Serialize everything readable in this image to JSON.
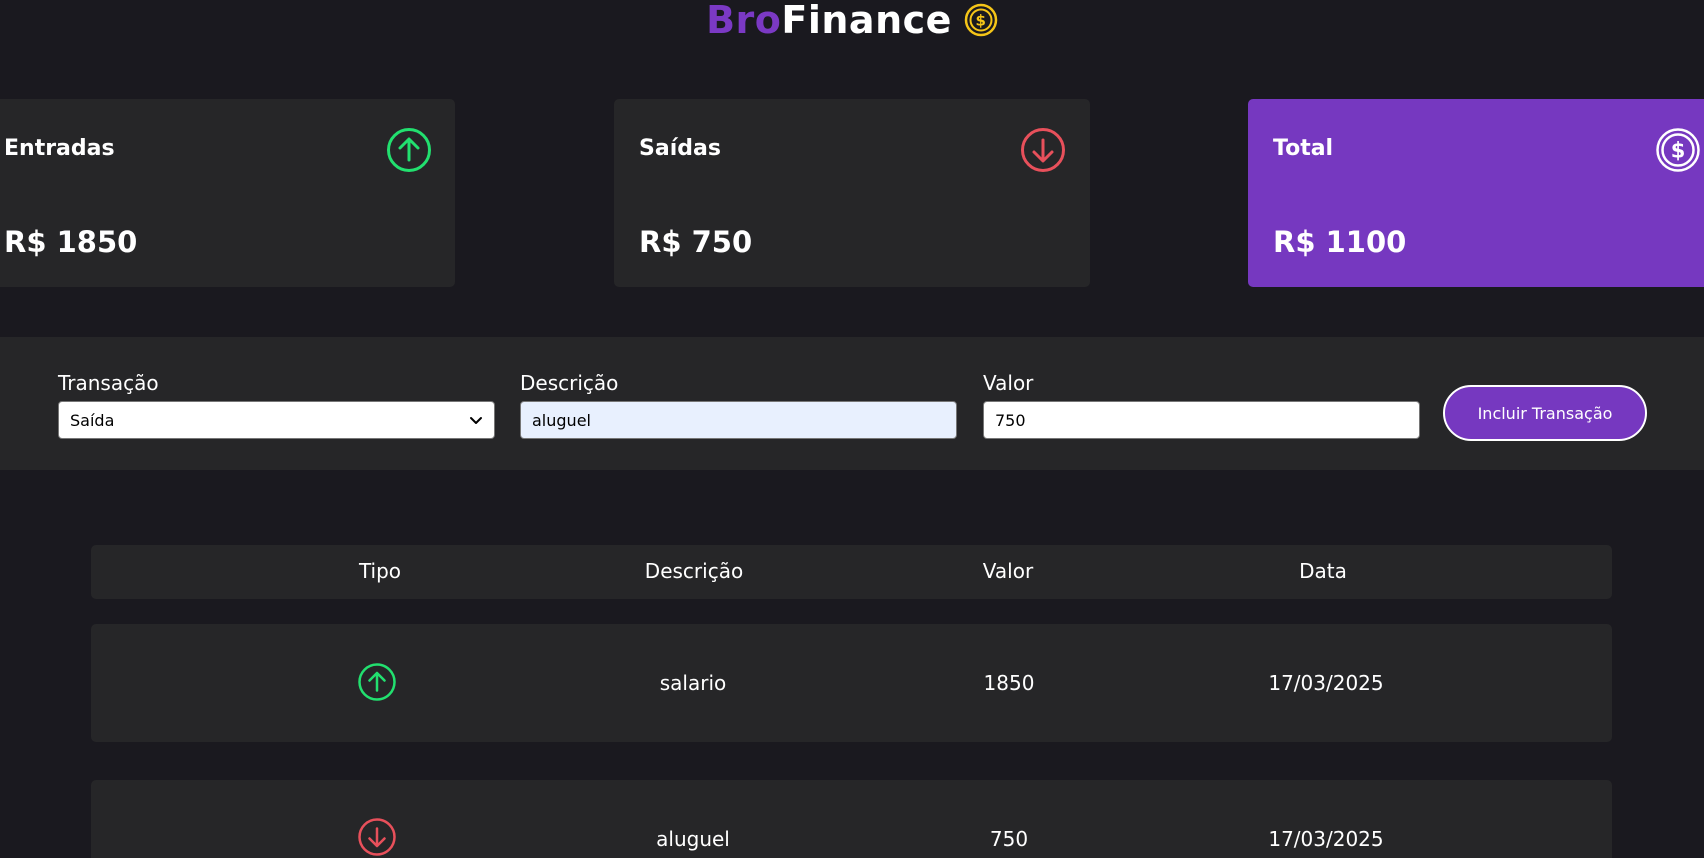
{
  "brand": {
    "part1": "Bro",
    "part2": "Finance",
    "icon": "dollar-coin-icon"
  },
  "summary": {
    "income": {
      "title": "Entradas",
      "value": "R$ 1850",
      "icon": "arrow-up-circle-icon",
      "color": "#22e06f"
    },
    "expense": {
      "title": "Saídas",
      "value": "R$ 750",
      "icon": "arrow-down-circle-icon",
      "color": "#e8505b"
    },
    "total": {
      "title": "Total",
      "value": "R$ 1100",
      "icon": "dollar-circle-icon",
      "color": "#7638c0"
    }
  },
  "form": {
    "type_label": "Transação",
    "type_value": "Saída",
    "description_label": "Descrição",
    "description_value": "aluguel",
    "amount_label": "Valor",
    "amount_value": "750",
    "submit_label": "Incluir Transação"
  },
  "table": {
    "headers": [
      "Tipo",
      "Descrição",
      "Valor",
      "Data"
    ],
    "rows": [
      {
        "type": "entrada",
        "icon": "arrow-up-circle-icon",
        "description": "salario",
        "amount": "1850",
        "date": "17/03/2025"
      },
      {
        "type": "saida",
        "icon": "arrow-down-circle-icon",
        "description": "aluguel",
        "amount": "750",
        "date": "17/03/2025"
      }
    ]
  },
  "colors": {
    "accent": "#7638c0",
    "background": "#1a191f",
    "card": "#262628",
    "coin": "#f5c518"
  }
}
